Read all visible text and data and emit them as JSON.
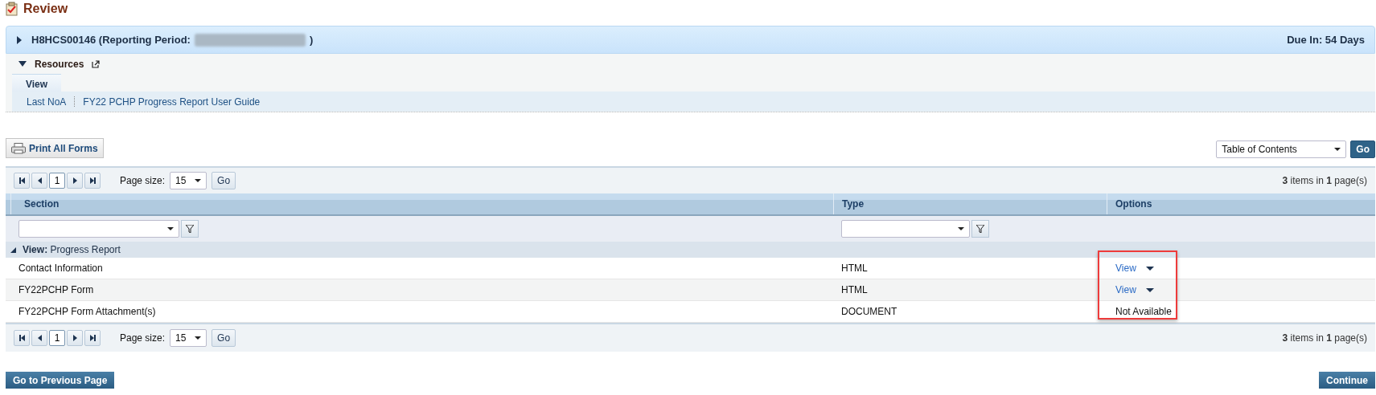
{
  "page_title": "Review",
  "header": {
    "expanded": false,
    "title": "H8HCS00146 (Reporting Period:",
    "title_end": ")",
    "due": "Due In: 54 Days"
  },
  "resources": {
    "expanded": true,
    "label": "Resources",
    "tabs": [
      {
        "label": "View",
        "selected": true
      }
    ],
    "links": [
      "Last NoA",
      "FY22 PCHP Progress Report User Guide"
    ]
  },
  "print_button": "Print All Forms",
  "toc_select": {
    "value": "Table of Contents",
    "go": "Go"
  },
  "pagers": [
    {
      "page": "1",
      "page_size_label": "Page size:",
      "page_size": "15",
      "go": "Go",
      "summary": "**3** items in **1** page(s)"
    },
    {
      "page": "1",
      "page_size_label": "Page size:",
      "page_size": "15",
      "go": "Go",
      "summary": "**3** items in **1** page(s)"
    }
  ],
  "table": {
    "columns": [
      "Section",
      "Type",
      "Options"
    ],
    "group": {
      "expanded": true,
      "label": "View:",
      "value": "Progress Report"
    },
    "options_highlighted": true,
    "rows": [
      {
        "section": "Contact Information",
        "type": "HTML",
        "option": {
          "kind": "menu",
          "label": "View"
        }
      },
      {
        "section": "FY22PCHP Form",
        "type": "HTML",
        "option": {
          "kind": "menu",
          "label": "View"
        }
      },
      {
        "section": "FY22PCHP Form Attachment(s)",
        "type": "DOCUMENT",
        "option": {
          "kind": "text",
          "label": "Not Available"
        }
      }
    ]
  },
  "footer_buttons": [
    "Go to Previous Page",
    "Continue"
  ]
}
